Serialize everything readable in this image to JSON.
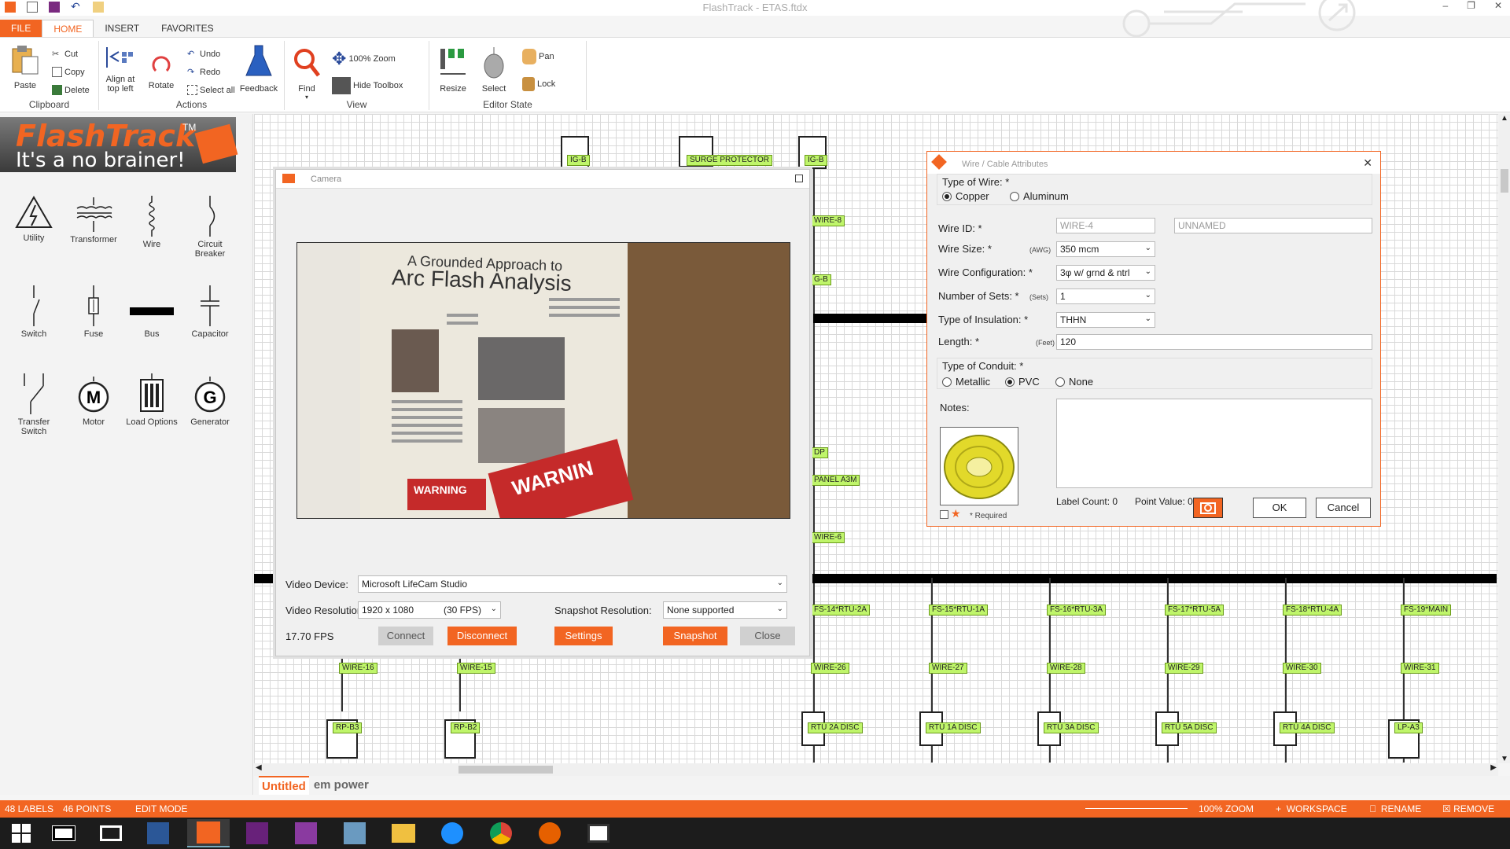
{
  "window": {
    "title": "FlashTrack - ETAS.ftdx",
    "min": "–",
    "restore": "❐",
    "close": "✕"
  },
  "tabs": [
    "FILE",
    "HOME",
    "INSERT",
    "FAVORITES"
  ],
  "ribbon": {
    "paste": "Paste",
    "cut": "Cut",
    "copy": "Copy",
    "delete": "Delete",
    "clipboard": "Clipboard",
    "align": "Align at top left",
    "rotate": "Rotate",
    "undo": "Undo",
    "redo": "Redo",
    "select_all": "Select all",
    "feedback": "Feedback",
    "actions": "Actions",
    "find": "Find",
    "zoom100": "100% Zoom",
    "hide_toolbox": "Hide Toolbox",
    "view": "View",
    "resize": "Resize",
    "select": "Select",
    "pan": "Pan",
    "lock": "Lock",
    "editor_state": "Editor State"
  },
  "logo": {
    "brand": "FlashTrack",
    "tm": "TM",
    "tagline": "It's a no brainer!"
  },
  "toolbox": [
    "Utility",
    "Transformer",
    "Wire",
    "Circuit Breaker",
    "Switch",
    "Fuse",
    "Bus",
    "Capacitor",
    "Transfer Switch",
    "Motor",
    "Load Options",
    "Generator"
  ],
  "canvas_labels": {
    "top": [
      "IG-B",
      "SURGE PROTECTOR",
      "IG-B"
    ],
    "mid": [
      "WIRE-8",
      "G-B",
      "DP",
      "PANEL A3M",
      "WIRE-6"
    ],
    "feeders": [
      "FS-14*RTU-2A",
      "FS-15*RTU-1A",
      "FS-16*RTU-3A",
      "FS-17*RTU-5A",
      "FS-18*RTU-4A",
      "FS-19*MAIN"
    ],
    "wires": [
      "WIRE-16",
      "WIRE-15",
      "WIRE-26",
      "WIRE-27",
      "WIRE-28",
      "WIRE-29",
      "WIRE-30",
      "WIRE-31"
    ],
    "loads": [
      "RP-B3",
      "RP-B2",
      "RTU 2A DISC",
      "RTU 1A DISC",
      "RTU 3A DISC",
      "RTU 5A DISC",
      "RTU 4A DISC",
      "LP-A3"
    ]
  },
  "camera": {
    "title": "Camera",
    "video_device_label": "Video Device:",
    "video_device": "Microsoft LifeCam Studio",
    "video_resolution_label": "Video Resolution:",
    "video_resolution": "1920 x 1080",
    "fps_option": "(30 FPS)",
    "snapshot_resolution_label": "Snapshot Resolution:",
    "snapshot_resolution": "None supported",
    "fps": "17.70 FPS",
    "connect": "Connect",
    "disconnect": "Disconnect",
    "settings": "Settings",
    "snapshot": "Snapshot",
    "close": "Close",
    "feed": {
      "headline1": "A Grounded Approach to",
      "headline2": "Arc Flash Analysis",
      "warn1": "WARNING",
      "warn2": "WARNIN"
    }
  },
  "wire_dialog": {
    "title": "Wire / Cable Attributes",
    "type_of_wire": "Type of Wire: *",
    "copper": "Copper",
    "aluminum": "Aluminum",
    "wire_id_label": "Wire ID: *",
    "wire_id": "WIRE-4",
    "unnamed": "UNNAMED",
    "wire_size_label": "Wire Size: *",
    "awg": "(AWG)",
    "wire_size": "350 mcm",
    "wire_config_label": "Wire Configuration: *",
    "wire_config": "3φ w/ grnd & ntrl",
    "sets_label": "Number of Sets: *",
    "sets_unit": "(Sets)",
    "sets": "1",
    "insulation_label": "Type of Insulation: *",
    "insulation": "THHN",
    "length_label": "Length: *",
    "feet": "(Feet)",
    "length": "120",
    "conduit_label": "Type of Conduit: *",
    "metallic": "Metallic",
    "pvc": "PVC",
    "none": "None",
    "notes_label": "Notes:",
    "required": "* Required",
    "label_count": "Label Count:  0",
    "point_value": "Point Value:  0",
    "ok": "OK",
    "cancel": "Cancel"
  },
  "doc_tabs": [
    "Untitled",
    "em power"
  ],
  "status": {
    "labels": "48  LABELS",
    "points": "46  POINTS",
    "mode": "EDIT MODE",
    "zoom": "100% ZOOM",
    "workspace": "WORKSPACE",
    "rename": "RENAME",
    "remove": "REMOVE"
  },
  "colors": {
    "accent": "#f26522",
    "label_green": "#bff56a",
    "bus": "#000000"
  }
}
